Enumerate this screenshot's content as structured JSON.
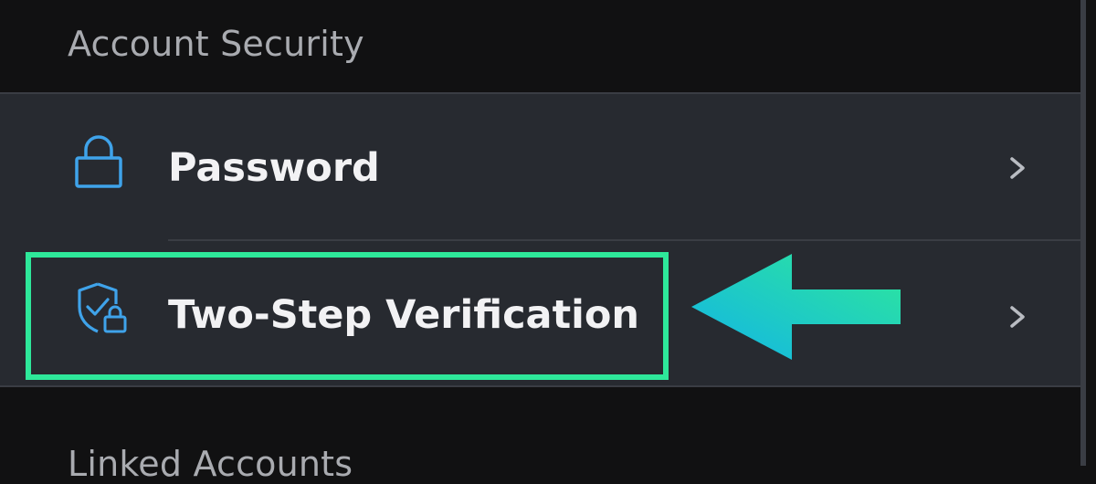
{
  "section_title": "Account Security",
  "next_section_title": "Linked Accounts",
  "items": [
    {
      "label": "Password",
      "icon": "lock-icon"
    },
    {
      "label": "Two-Step Verification",
      "icon": "shield-lock-icon"
    }
  ],
  "colors": {
    "icon": "#3fa3ea",
    "highlight": "#2ee89a",
    "arrow_start": "#12b4e6",
    "arrow_end": "#2ee89a"
  }
}
